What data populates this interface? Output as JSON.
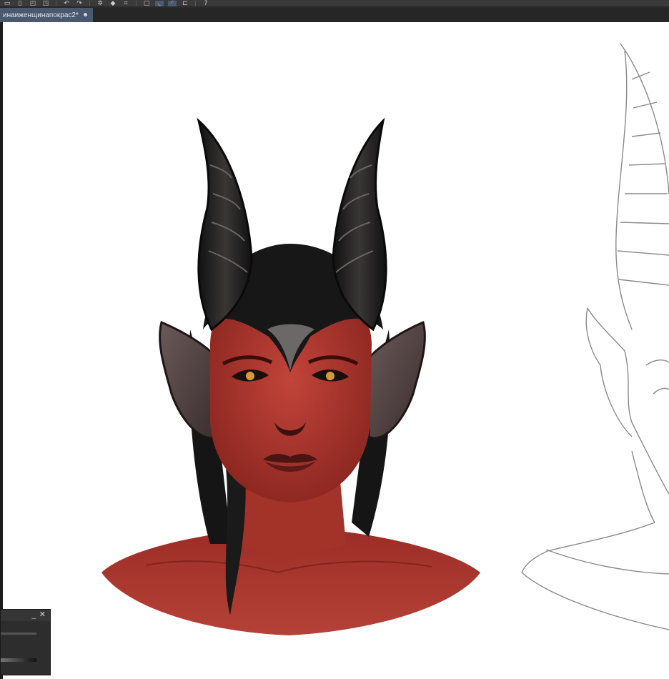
{
  "document": {
    "tab_title": "инаиженщинапокрас2*"
  },
  "toolbar": {
    "icons": [
      "brush-icon",
      "eraser-icon",
      "selection-icon",
      "lasso-icon",
      "undo-icon",
      "redo-icon",
      "transform-icon",
      "fill-icon",
      "crop-icon",
      "view-icon",
      "rotate-icon",
      "mirror-icon",
      "settings-icon"
    ]
  },
  "panel": {
    "minimize_glyph": "_",
    "close_glyph": "✕"
  },
  "colors": {
    "canvas": "#ffffff",
    "tab_active": "#4a5870",
    "skin": "#a8322a",
    "horn": "#1f1b1b",
    "hair": "#151515",
    "sketch_line": "#8a8a8a"
  }
}
